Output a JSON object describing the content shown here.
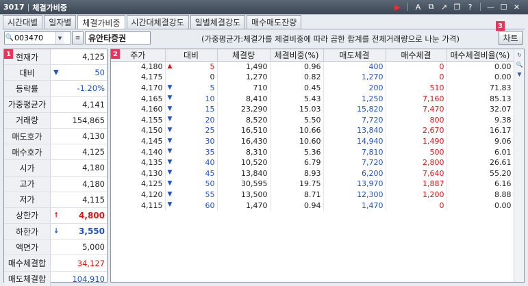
{
  "window": {
    "code": "3017",
    "separator": "|",
    "title": "체결가비중"
  },
  "tabs": [
    {
      "label": "시간대별",
      "active": false
    },
    {
      "label": "일자별",
      "active": false
    },
    {
      "label": "체결가비중",
      "active": true
    },
    {
      "label": "시간대체결강도",
      "active": false
    },
    {
      "label": "일별체결강도",
      "active": false
    },
    {
      "label": "매수매도잔량",
      "active": false
    }
  ],
  "toolbar": {
    "stock_code": "003470",
    "stock_name": "유안타증권",
    "description": "(가중평균가:체결가를 체결비중에 따라 곱한 합계를 전체거래량으로 나눈 가격)",
    "chart_button": "차트"
  },
  "badges": {
    "left": "1",
    "right": "2",
    "chart": "3"
  },
  "left_panel": [
    {
      "label": "현재가",
      "value": "4,125",
      "color": "",
      "arrow": ""
    },
    {
      "label": "대비",
      "value": "50",
      "color": "blue",
      "arrow": "▼"
    },
    {
      "label": "등락률",
      "value": "-1.20%",
      "color": "blue",
      "arrow": ""
    },
    {
      "label": "가중평균가",
      "value": "4,141",
      "color": "",
      "arrow": ""
    },
    {
      "label": "거래량",
      "value": "154,865",
      "color": "",
      "arrow": ""
    },
    {
      "label": "매도호가",
      "value": "4,130",
      "color": "",
      "arrow": ""
    },
    {
      "label": "매수호가",
      "value": "4,125",
      "color": "",
      "arrow": ""
    },
    {
      "label": "시가",
      "value": "4,180",
      "color": "",
      "arrow": ""
    },
    {
      "label": "고가",
      "value": "4,180",
      "color": "",
      "arrow": ""
    },
    {
      "label": "저가",
      "value": "4,115",
      "color": "",
      "arrow": ""
    },
    {
      "label": "상한가",
      "value": "4,800",
      "color": "red",
      "arrow": "↑",
      "bold": true
    },
    {
      "label": "하한가",
      "value": "3,550",
      "color": "blue",
      "arrow": "↓",
      "bold": true
    },
    {
      "label": "액면가",
      "value": "5,000",
      "color": "",
      "arrow": ""
    },
    {
      "label": "매수체결합",
      "value": "34,127",
      "color": "red",
      "arrow": ""
    },
    {
      "label": "매도체결합",
      "value": "104,910",
      "color": "blue",
      "arrow": ""
    }
  ],
  "table": {
    "headers": [
      "주가",
      "대비",
      "체결량",
      "체결비중(%)",
      "매도체결",
      "매수체결",
      "매수체결비율(%)"
    ],
    "rows": [
      [
        "4,180",
        "▲",
        "5",
        "1,490",
        "0.96",
        "400",
        "0",
        "0.00"
      ],
      [
        "4,175",
        "",
        "0",
        "1,270",
        "0.82",
        "1,270",
        "0",
        "0.00"
      ],
      [
        "4,170",
        "▼",
        "5",
        "710",
        "0.45",
        "200",
        "510",
        "71.83"
      ],
      [
        "4,165",
        "▼",
        "10",
        "8,410",
        "5.43",
        "1,250",
        "7,160",
        "85.13"
      ],
      [
        "4,160",
        "▼",
        "15",
        "23,290",
        "15.03",
        "15,820",
        "7,470",
        "32.07"
      ],
      [
        "4,155",
        "▼",
        "20",
        "8,520",
        "5.50",
        "7,720",
        "800",
        "9.38"
      ],
      [
        "4,150",
        "▼",
        "25",
        "16,510",
        "10.66",
        "13,840",
        "2,670",
        "16.17"
      ],
      [
        "4,145",
        "▼",
        "30",
        "16,430",
        "10.60",
        "14,940",
        "1,490",
        "9.06"
      ],
      [
        "4,140",
        "▼",
        "35",
        "8,310",
        "5.36",
        "7,810",
        "500",
        "6.01"
      ],
      [
        "4,135",
        "▼",
        "40",
        "10,520",
        "6.79",
        "7,720",
        "2,800",
        "26.61"
      ],
      [
        "4,130",
        "▼",
        "45",
        "13,840",
        "8.93",
        "6,200",
        "7,640",
        "55.20"
      ],
      [
        "4,125",
        "▼",
        "50",
        "30,595",
        "19.75",
        "13,970",
        "1,887",
        "6.16"
      ],
      [
        "4,120",
        "▼",
        "55",
        "13,500",
        "8.71",
        "12,300",
        "1,200",
        "8.88"
      ],
      [
        "4,115",
        "▼",
        "60",
        "1,470",
        "0.94",
        "1,470",
        "0",
        "0.00"
      ]
    ]
  },
  "colors": {
    "up": "#e01414",
    "down": "#1e50c8",
    "badge": "#e8355a"
  }
}
